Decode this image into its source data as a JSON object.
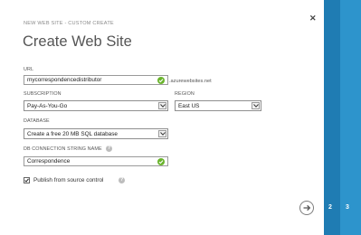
{
  "wizard": {
    "breadcrumb": "NEW WEB SITE - CUSTOM CREATE",
    "title": "Create Web Site"
  },
  "form": {
    "url_label": "URL",
    "url_value": "mycorrespondencedistributor",
    "url_suffix": ".azurewebsites.net",
    "subscription_label": "SUBSCRIPTION",
    "subscription_value": "Pay-As-You-Go",
    "region_label": "REGION",
    "region_value": "East US",
    "database_label": "DATABASE",
    "database_value": "Create a free 20 MB SQL database",
    "db_conn_label": "DB CONNECTION STRING NAME",
    "db_conn_value": "Correspondence",
    "publish_label": "Publish from source control",
    "publish_checked": true
  },
  "steps": {
    "step2": "2",
    "step3": "3"
  },
  "icons": {
    "close": "close-icon",
    "next": "arrow-right-icon",
    "valid": "check-circle-icon",
    "help": "help-icon"
  },
  "colors": {
    "accent_dark": "#1f7cb3",
    "accent_light": "#2d94cc",
    "valid": "#6ab42d"
  }
}
